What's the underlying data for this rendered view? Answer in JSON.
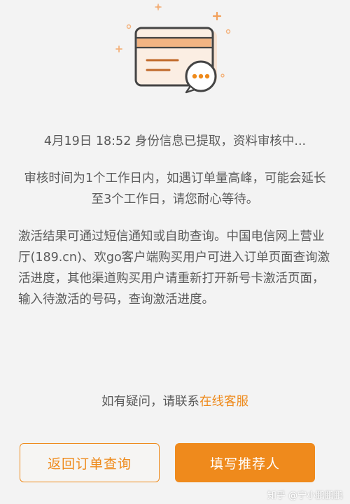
{
  "illustration": {
    "icon": "card-with-chat-bubble-illustration",
    "accent_color": "#ee8a1b"
  },
  "status": {
    "date": "4月19日",
    "time": "18:52",
    "message": "身份信息已提取，资料审核中..."
  },
  "review_notice": "审核时间为1个工作日内，如遇订单量高峰，可能会延长至3个工作日，请您耐心等待。",
  "activation_notice": "激活结果可通过短信通知或自助查询。中国电信网上营业厅(189.cn)、欢go客户端购买用户可进入订单页面查询激活进度，其他渠道购买用户请重新打开新号卡激活页面，输入待激活的号码，查询激活进度。",
  "help": {
    "prefix": "如有疑问，请联系",
    "link_label": "在线客服"
  },
  "buttons": {
    "back_label": "返回订单查询",
    "referrer_label": "填写推荐人"
  },
  "watermark": "知乎 @宁小鹏鹏鹏",
  "colors": {
    "accent": "#ee8a1b",
    "text": "#5a5a5a",
    "background": "#f3f3f3"
  }
}
